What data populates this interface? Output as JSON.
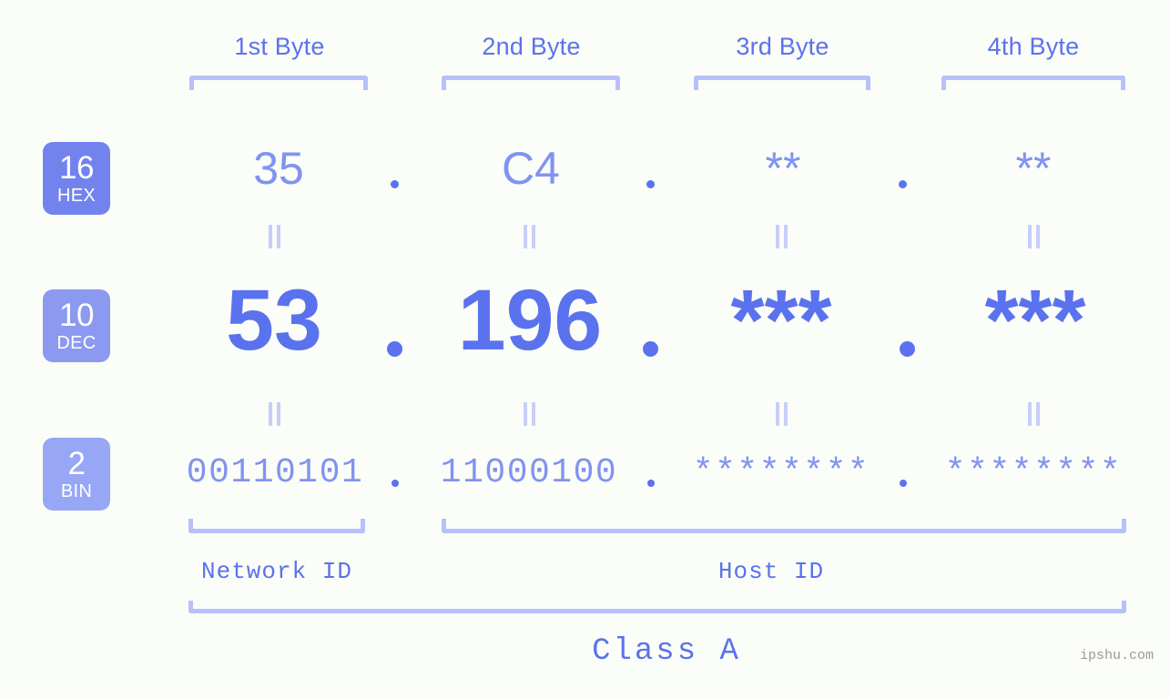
{
  "background_color": "#fbfdf8",
  "accent_color": "#5b72ee",
  "accent_light_color": "#8193f0",
  "bracket_color": "#b6c1fb",
  "byte_headers": [
    {
      "label": "1st Byte"
    },
    {
      "label": "2nd Byte"
    },
    {
      "label": "3rd Byte"
    },
    {
      "label": "4th Byte"
    }
  ],
  "rows": [
    {
      "badge": {
        "number": "16",
        "abbr": "HEX",
        "color": "#7383ee"
      },
      "values": [
        "35",
        "C4",
        "**",
        "**"
      ],
      "separator": "."
    },
    {
      "badge": {
        "number": "10",
        "abbr": "DEC",
        "color": "#8c99f0"
      },
      "values": [
        "53",
        "196",
        "***",
        "***"
      ],
      "separator": "."
    },
    {
      "badge": {
        "number": "2",
        "abbr": "BIN",
        "color": "#97a6f5"
      },
      "values": [
        "00110101",
        "11000100",
        "********",
        "********"
      ],
      "separator": "."
    }
  ],
  "segments": {
    "network_id": "Network ID",
    "host_id": "Host ID"
  },
  "ip_class": "Class A",
  "watermark": "ipshu.com"
}
